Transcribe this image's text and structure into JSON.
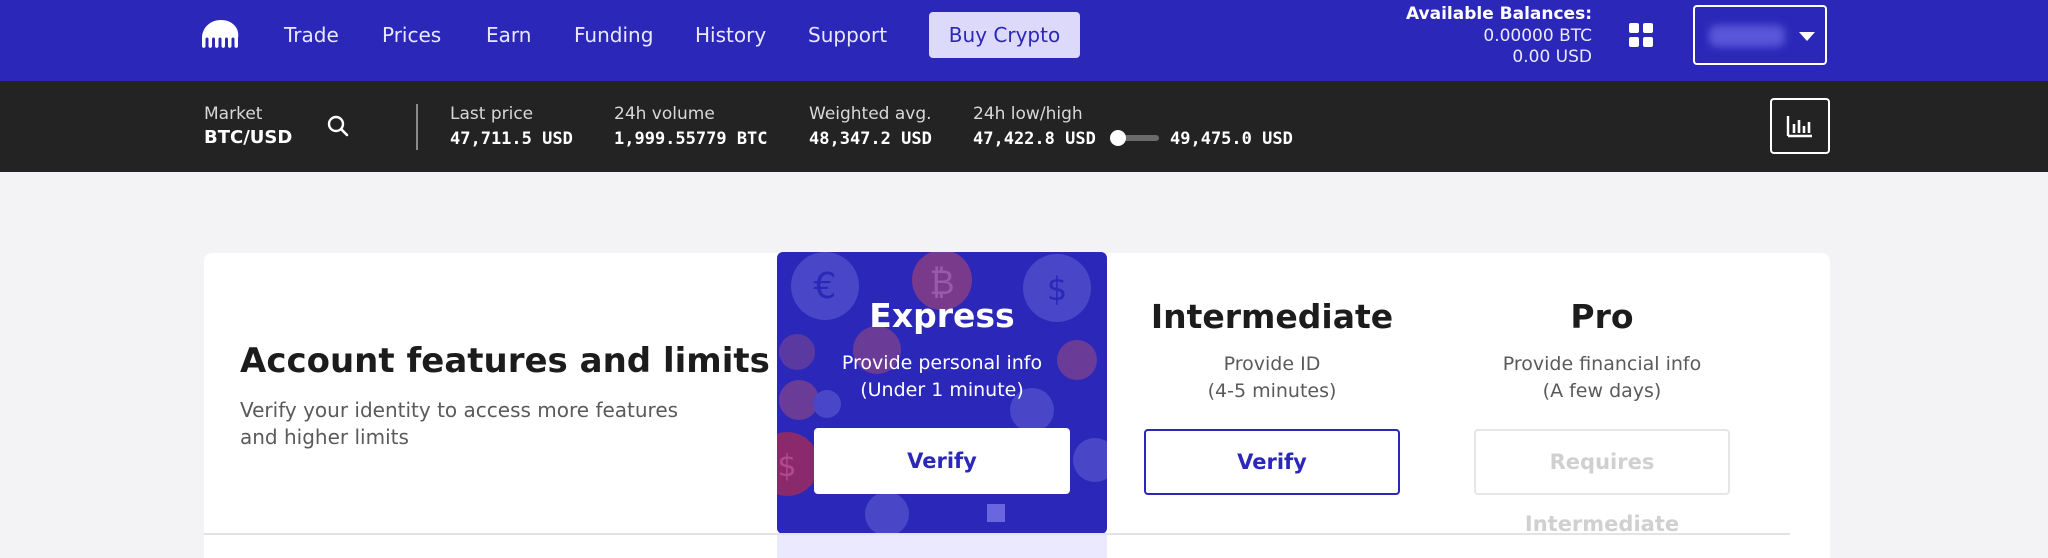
{
  "nav": {
    "items": [
      {
        "label": "Trade"
      },
      {
        "label": "Prices"
      },
      {
        "label": "Earn"
      },
      {
        "label": "Funding"
      },
      {
        "label": "History"
      },
      {
        "label": "Support"
      }
    ],
    "buy_button": "Buy Crypto",
    "balances": {
      "title": "Available Balances:",
      "btc": "0.00000 BTC",
      "usd": "0.00 USD"
    },
    "icons": {
      "logo": "kraken-logo",
      "apps": "grid-icon",
      "account_menu": "chevron-down-icon"
    }
  },
  "ticker": {
    "market_label": "Market",
    "market_value": "BTC/USD",
    "last_price_label": "Last price",
    "last_price_value": "47,711.5 USD",
    "volume_label": "24h volume",
    "volume_value": "1,999.55779 BTC",
    "weighted_label": "Weighted avg.",
    "weighted_value": "48,347.2 USD",
    "lowhigh_label": "24h low/high",
    "low_value": "47,422.8 USD",
    "high_value": "49,475.0 USD",
    "range_position": 0.14,
    "icons": {
      "search": "search-icon",
      "chart": "bar-chart-icon"
    }
  },
  "account": {
    "title": "Account features and limits",
    "description": "Verify your identity to access more features and higher limits",
    "tiers": [
      {
        "name": "Express",
        "line1": "Provide personal info",
        "line2": "(Under 1 minute)",
        "button": "Verify"
      },
      {
        "name": "Intermediate",
        "line1": "Provide ID",
        "line2": "(4-5 minutes)",
        "button": "Verify"
      },
      {
        "name": "Pro",
        "line1": "Provide financial info",
        "line2": "(A few days)",
        "button": "Requires Intermediate"
      }
    ]
  },
  "colors": {
    "brand": "#2b27b8",
    "ticker_bg": "#232323",
    "page_bg": "#f3f3f5"
  }
}
